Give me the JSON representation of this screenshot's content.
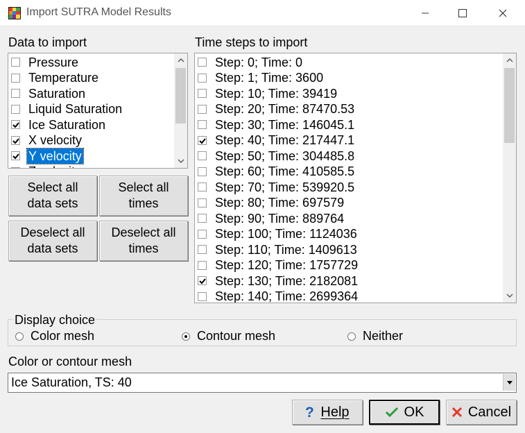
{
  "window": {
    "title": "Import SUTRA Model Results"
  },
  "data_to_import": {
    "label": "Data to import",
    "items": [
      {
        "label": "Pressure",
        "checked": false,
        "selected": false
      },
      {
        "label": "Temperature",
        "checked": false,
        "selected": false
      },
      {
        "label": "Saturation",
        "checked": false,
        "selected": false
      },
      {
        "label": "Liquid Saturation",
        "checked": false,
        "selected": false
      },
      {
        "label": "Ice Saturation",
        "checked": true,
        "selected": false
      },
      {
        "label": "X velocity",
        "checked": true,
        "selected": false
      },
      {
        "label": "Y velocity",
        "checked": true,
        "selected": true
      },
      {
        "label": "Z velocity",
        "checked": false,
        "selected": false
      }
    ]
  },
  "time_steps": {
    "label": "Time steps to import",
    "items": [
      {
        "label": "Step: 0; Time: 0",
        "checked": false
      },
      {
        "label": "Step: 1; Time: 3600",
        "checked": false
      },
      {
        "label": "Step: 10; Time: 39419",
        "checked": false
      },
      {
        "label": "Step: 20; Time: 87470.53",
        "checked": false
      },
      {
        "label": "Step: 30; Time: 146045.1",
        "checked": false
      },
      {
        "label": "Step: 40; Time: 217447.1",
        "checked": true
      },
      {
        "label": "Step: 50; Time: 304485.8",
        "checked": false
      },
      {
        "label": "Step: 60; Time: 410585.5",
        "checked": false
      },
      {
        "label": "Step: 70; Time: 539920.5",
        "checked": false
      },
      {
        "label": "Step: 80; Time: 697579",
        "checked": false
      },
      {
        "label": "Step: 90; Time: 889764",
        "checked": false
      },
      {
        "label": "Step: 100; Time: 1124036",
        "checked": false
      },
      {
        "label": "Step: 110; Time: 1409613",
        "checked": false
      },
      {
        "label": "Step: 120; Time: 1757729",
        "checked": false
      },
      {
        "label": "Step: 130; Time: 2182081",
        "checked": true
      },
      {
        "label": "Step: 140; Time: 2699364",
        "checked": false
      }
    ]
  },
  "buttons": {
    "select_all_data_sets": "Select all\ndata sets",
    "select_all_times": "Select all\ntimes",
    "deselect_all_data_sets": "Deselect all\ndata sets",
    "deselect_all_times": "Deselect all\ntimes"
  },
  "display_choice": {
    "label": "Display choice",
    "options": [
      {
        "label": "Color mesh",
        "selected": false
      },
      {
        "label": "Contour mesh",
        "selected": true
      },
      {
        "label": "Neither",
        "selected": false
      }
    ]
  },
  "mesh": {
    "label": "Color or contour mesh",
    "value": "Ice Saturation, TS: 40"
  },
  "actions": {
    "help": "Help",
    "ok": "OK",
    "cancel": "Cancel"
  },
  "colors": {
    "selection": "#0078d7",
    "ok_icon": "#2e9a3a",
    "cancel_icon": "#e0392b",
    "help_icon": "#1c5fb8"
  }
}
